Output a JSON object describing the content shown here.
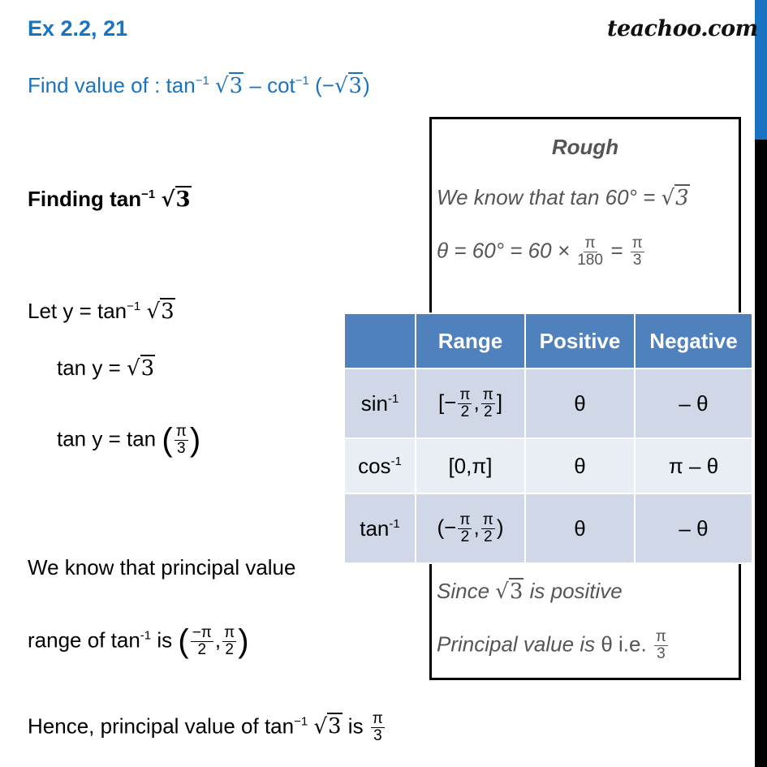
{
  "header": {
    "exercise": "Ex 2.2, 21",
    "brand": "teachoo.com",
    "question_prefix": "Find value of : tan",
    "question_sup1": "−1",
    "question_mid": " – cot",
    "question_sup2": "−1",
    "question_arg2_open": " (−",
    "question_arg2_close": ")",
    "radicand": "3"
  },
  "colors": {
    "accent": "#1a73c0",
    "table_header": "#4f81bd",
    "table_row_dark": "#d0d8e8",
    "table_row_light": "#e9edf4",
    "rough_text": "#555555"
  },
  "solution": {
    "finding_label": "Finding  tan",
    "sup": "−1",
    "let_prefix": "Let y =  tan",
    "tan_y_eq": "tan y = ",
    "tan_y_tan": "tan y = tan ",
    "pi": "π",
    "three": "3",
    "two": "2",
    "neg_pi": "−π",
    "we_know": "We know that principal value",
    "range_prefix": "range of tan",
    "range_is": " is ",
    "hence_prefix": "Hence, principal value of tan",
    "hence_is": " is "
  },
  "rough": {
    "title": "Rough",
    "line1": "We know that tan 60° = ",
    "line2": "θ = 60° = 60 × ",
    "line2_num": "π",
    "line2_den": "180",
    "line2_eq": " = ",
    "line3_prefix": "Since ",
    "line3_suffix": " is positive",
    "line4": "Principal value is  ",
    "line4_theta": "θ i.e. "
  },
  "table": {
    "headers": [
      "",
      "Range",
      "Positive",
      "Negative"
    ],
    "rows": [
      {
        "func": "sin",
        "sup": "-1",
        "range_open": "[−",
        "range_close": "]",
        "positive": "θ",
        "negative": "– θ"
      },
      {
        "func": "cos",
        "sup": "-1",
        "range": "[0,π]",
        "positive": "θ",
        "negative": "π – θ"
      },
      {
        "func": "tan",
        "sup": "-1",
        "range_open": "(−",
        "range_close": ")",
        "positive": "θ",
        "negative": "– θ"
      }
    ]
  }
}
